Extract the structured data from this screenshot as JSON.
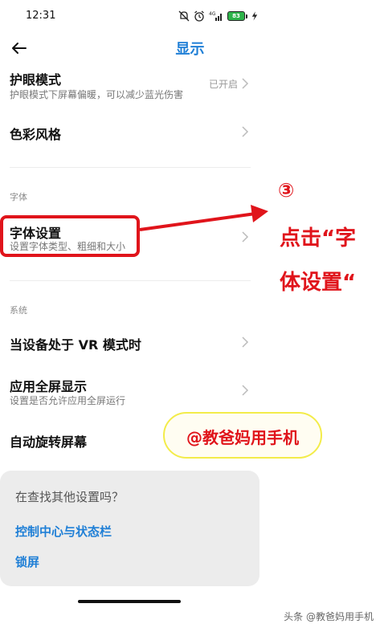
{
  "status": {
    "time": "12:31",
    "battery": "83"
  },
  "header": {
    "title": "显示"
  },
  "rows": {
    "eye": {
      "title": "护眼模式",
      "subtitle": "护眼模式下屏幕偏暖，可以减少蓝光伤害",
      "value": "已开启"
    },
    "color": {
      "title": "色彩风格"
    },
    "font_section": "字体",
    "font": {
      "title": "字体设置",
      "subtitle": "设置字体类型、粗细和大小"
    },
    "system_section": "系统",
    "vr": {
      "title": "当设备处于 VR 模式时"
    },
    "fullscreen": {
      "title": "应用全屏显示",
      "subtitle": "设置是否允许应用全屏运行"
    },
    "rotate": {
      "title": "自动旋转屏幕"
    }
  },
  "popup": {
    "question": "在查找其他设置吗？",
    "link1": "控制中心与状态栏",
    "link2": "锁屏"
  },
  "annotation": {
    "step": "③",
    "line1": "点击“字",
    "line2": "体设置“"
  },
  "watermark": "@教爸妈用手机",
  "credit": "头条 @教爸妈用手机",
  "colors": {
    "accent": "#1f7fd6",
    "annotation_red": "#e0141b"
  }
}
